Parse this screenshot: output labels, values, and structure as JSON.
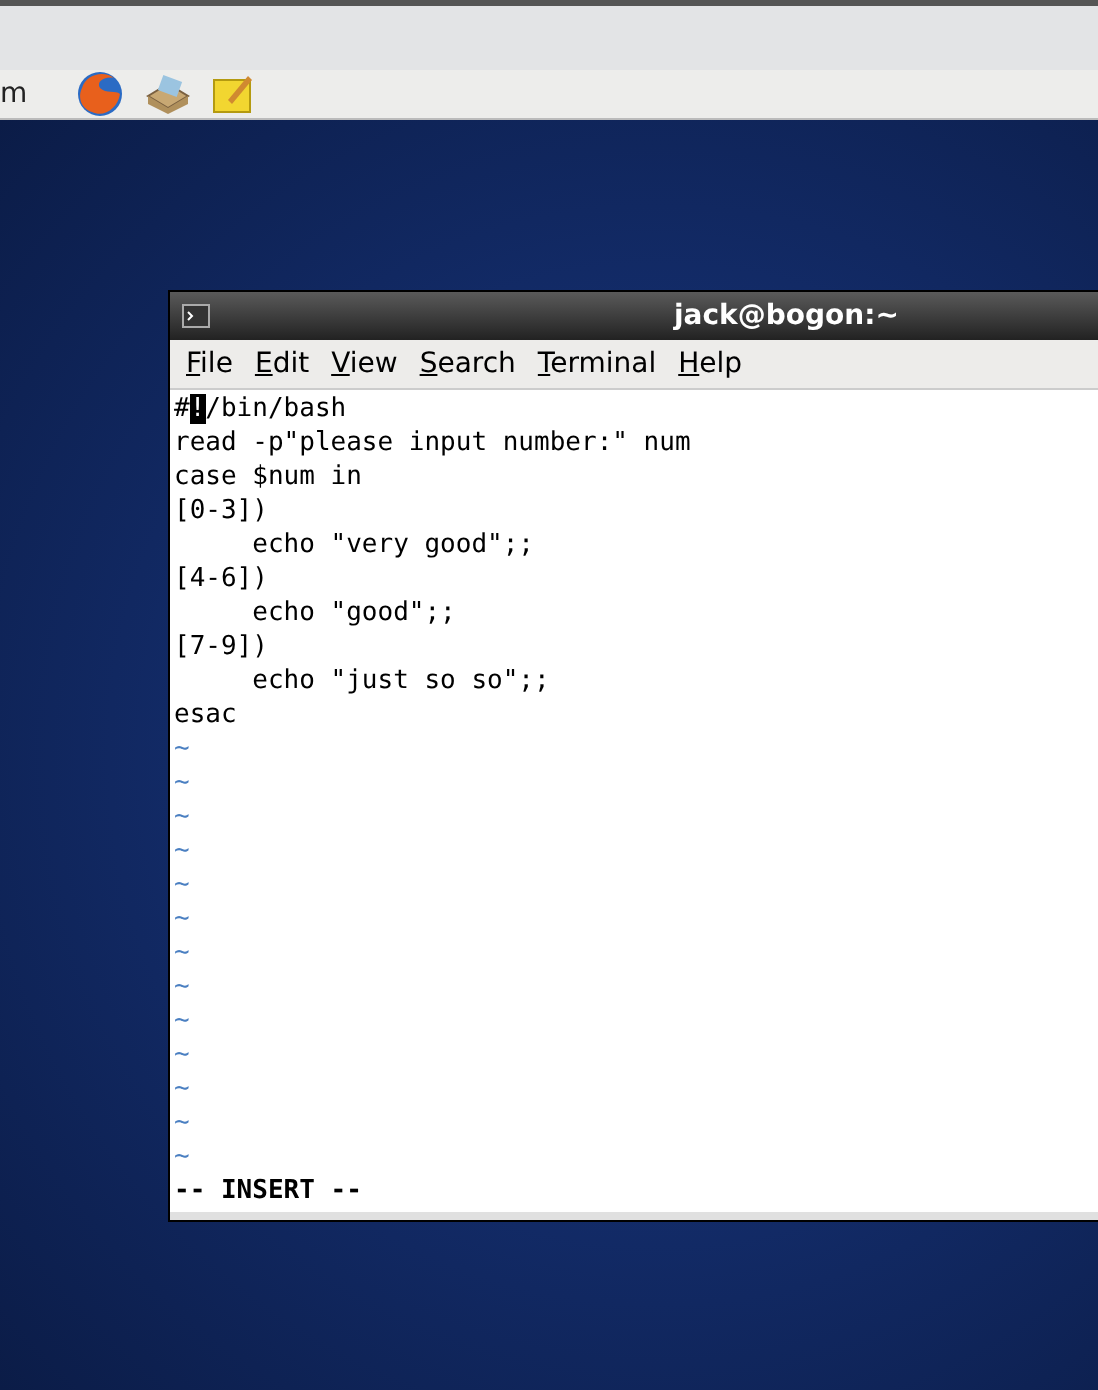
{
  "panel": {
    "label": "m"
  },
  "terminal": {
    "title": "jack@bogon:~",
    "menu": [
      "File",
      "Edit",
      "View",
      "Search",
      "Terminal",
      "Help"
    ],
    "lines": [
      {
        "kind": "cursor",
        "before": "#",
        "cursor": "!",
        "after": "/bin/bash"
      },
      {
        "kind": "text",
        "text": "read -p\"please input number:\" num"
      },
      {
        "kind": "text",
        "text": "case $num in"
      },
      {
        "kind": "text",
        "text": "[0-3])"
      },
      {
        "kind": "text",
        "text": "     echo \"very good\";;"
      },
      {
        "kind": "text",
        "text": "[4-6])"
      },
      {
        "kind": "text",
        "text": "     echo \"good\";;"
      },
      {
        "kind": "text",
        "text": "[7-9])"
      },
      {
        "kind": "text",
        "text": "     echo \"just so so\";;"
      },
      {
        "kind": "text",
        "text": "esac"
      },
      {
        "kind": "tilde",
        "text": "~"
      },
      {
        "kind": "tilde",
        "text": "~"
      },
      {
        "kind": "tilde",
        "text": "~"
      },
      {
        "kind": "tilde",
        "text": "~"
      },
      {
        "kind": "tilde",
        "text": "~"
      },
      {
        "kind": "tilde",
        "text": "~"
      },
      {
        "kind": "tilde",
        "text": "~"
      },
      {
        "kind": "tilde",
        "text": "~"
      },
      {
        "kind": "tilde",
        "text": "~"
      },
      {
        "kind": "tilde",
        "text": "~"
      },
      {
        "kind": "tilde",
        "text": "~"
      },
      {
        "kind": "tilde",
        "text": "~"
      },
      {
        "kind": "tilde",
        "text": "~"
      }
    ],
    "mode": "-- INSERT --"
  }
}
